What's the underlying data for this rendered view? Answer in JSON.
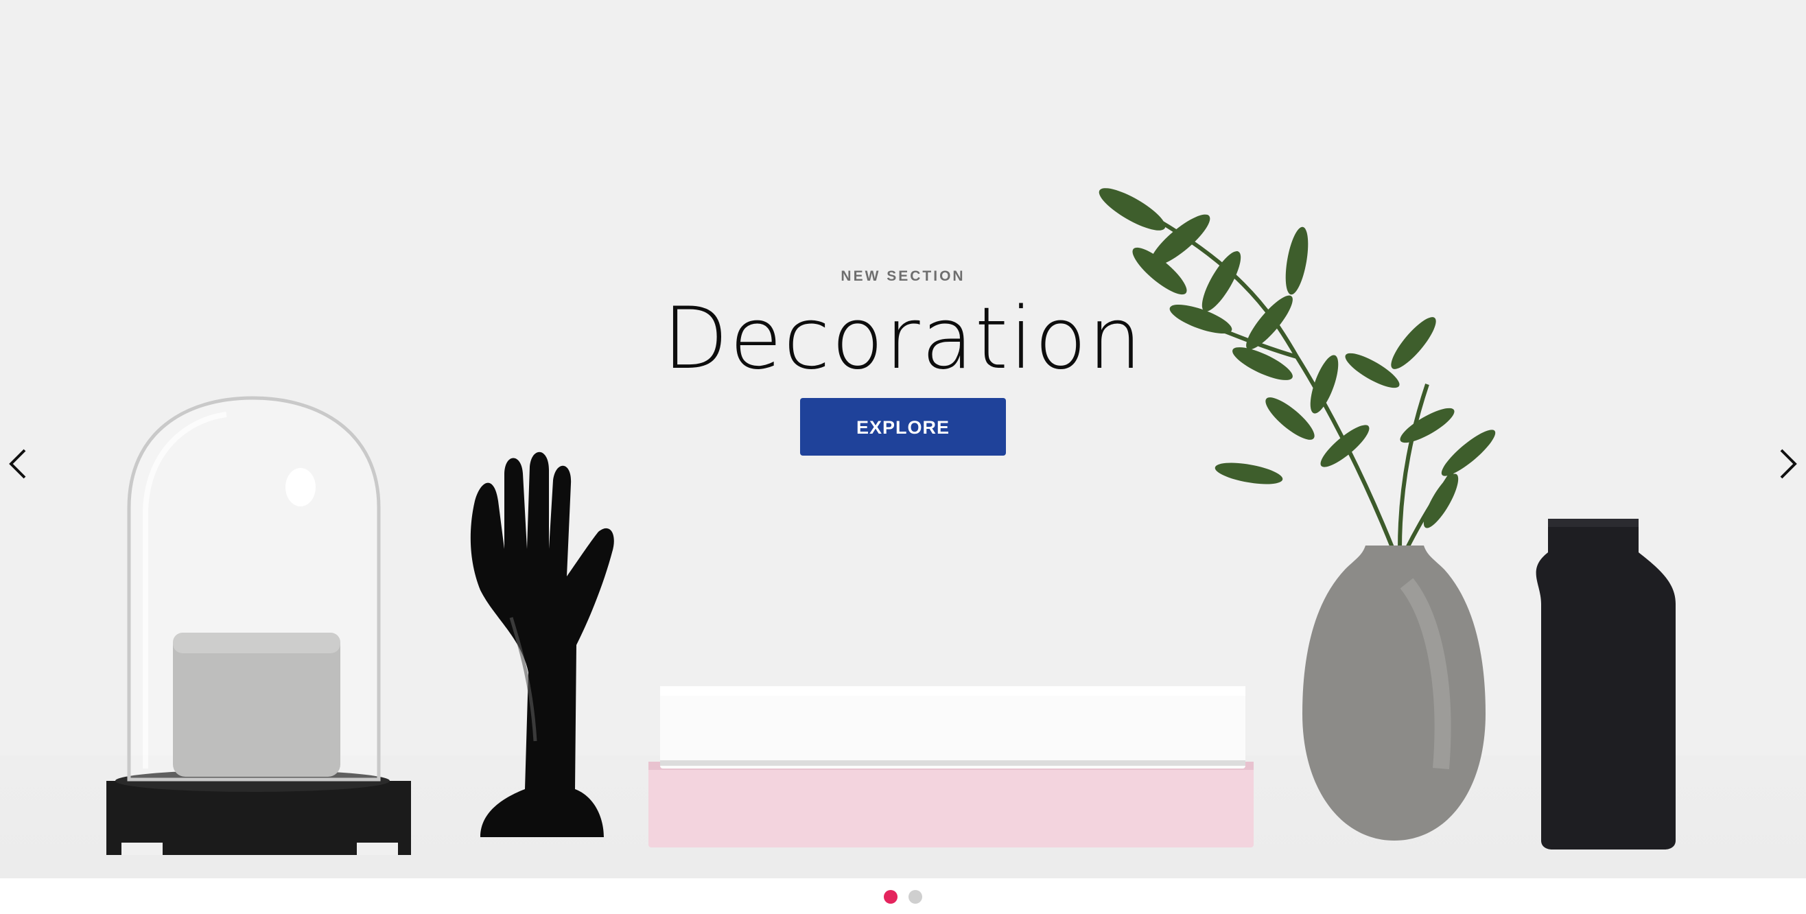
{
  "hero": {
    "eyebrow": "NEW SECTION",
    "title": "Decoration",
    "cta_label": "EXPLORE"
  },
  "slider": {
    "prev_icon": "chevron-left-icon",
    "next_icon": "chevron-right-icon",
    "slide_count": 2,
    "active_slide": 1
  },
  "colors": {
    "background": "#f0f0f0",
    "cta": "#1f429a",
    "dot_active": "#e4245d",
    "dot_inactive": "#cfcfcf"
  },
  "image_objects": [
    "glass-cloche-icon",
    "ceramic-hand-icon",
    "stacked-books-icon",
    "grey-vase-with-plant-icon",
    "black-bottle-vase-icon"
  ]
}
